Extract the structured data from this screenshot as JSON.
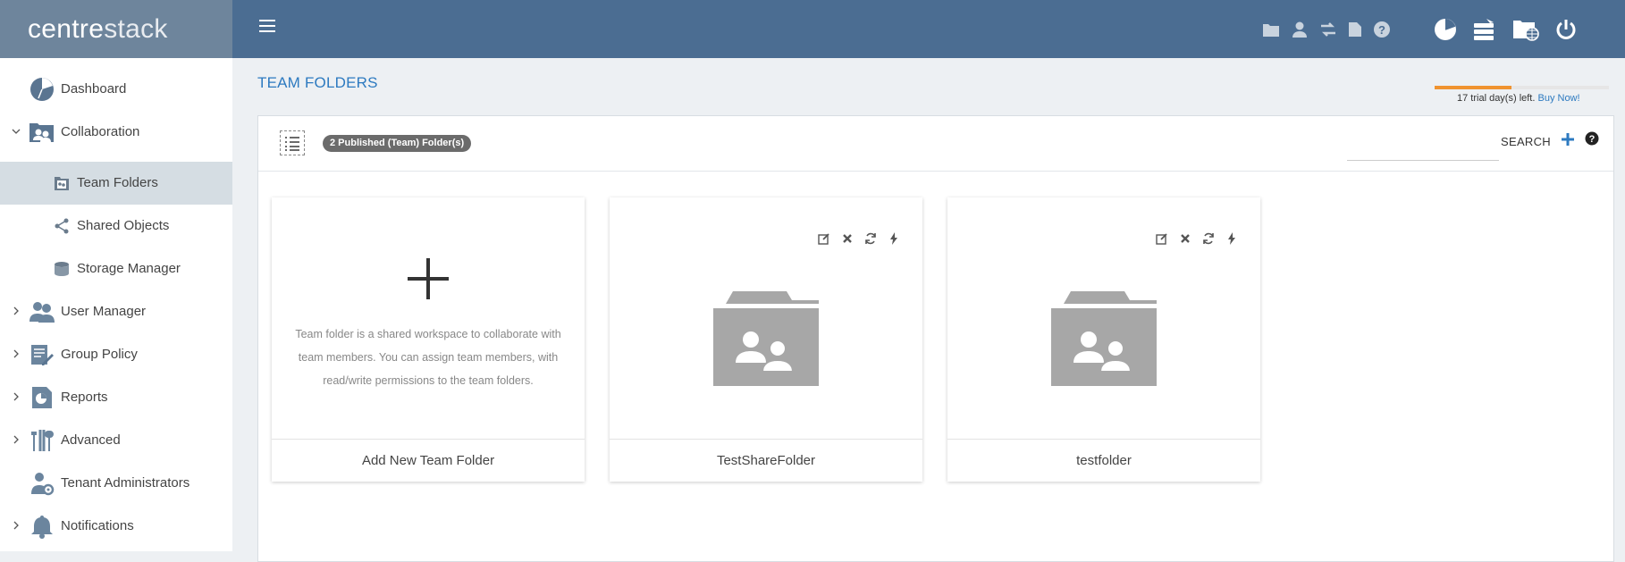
{
  "header": {
    "logo_light": "centre",
    "logo_bold": "stack",
    "small_icons": [
      "folder-icon",
      "user-icon",
      "transfer-icon",
      "document-icon",
      "help-circle-icon"
    ],
    "big_icons": [
      "pie-chart-icon",
      "server-stack-icon",
      "globe-folder-icon",
      "power-icon"
    ]
  },
  "sidebar": {
    "items": [
      {
        "label": "Dashboard",
        "icon": "dashboard-icon"
      },
      {
        "label": "Collaboration",
        "icon": "collaboration-icon"
      },
      {
        "label": "Team Folders",
        "icon": "team-folder-icon"
      },
      {
        "label": "Shared Objects",
        "icon": "share-icon"
      },
      {
        "label": "Storage Manager",
        "icon": "storage-icon"
      },
      {
        "label": "User Manager",
        "icon": "users-icon"
      },
      {
        "label": "Group Policy",
        "icon": "policy-icon"
      },
      {
        "label": "Reports",
        "icon": "reports-icon"
      },
      {
        "label": "Advanced",
        "icon": "tools-icon"
      },
      {
        "label": "Tenant Administrators",
        "icon": "admin-gear-icon"
      },
      {
        "label": "Notifications",
        "icon": "bell-icon"
      }
    ]
  },
  "main": {
    "title": "TEAM FOLDERS",
    "trial": {
      "text": "17 trial day(s) left.",
      "link": "Buy Now!",
      "progress": 0.44
    },
    "toolbar": {
      "badge": "2 Published (Team) Folder(s)",
      "search_label": "SEARCH",
      "search_placeholder": ""
    },
    "cards": [
      {
        "name": "Add New Team Folder",
        "description": "Team folder is a shared workspace to collaborate with team members. You can assign team members, with read/write permissions to the team folders."
      },
      {
        "name": "TestShareFolder"
      },
      {
        "name": "testfolder"
      }
    ]
  }
}
